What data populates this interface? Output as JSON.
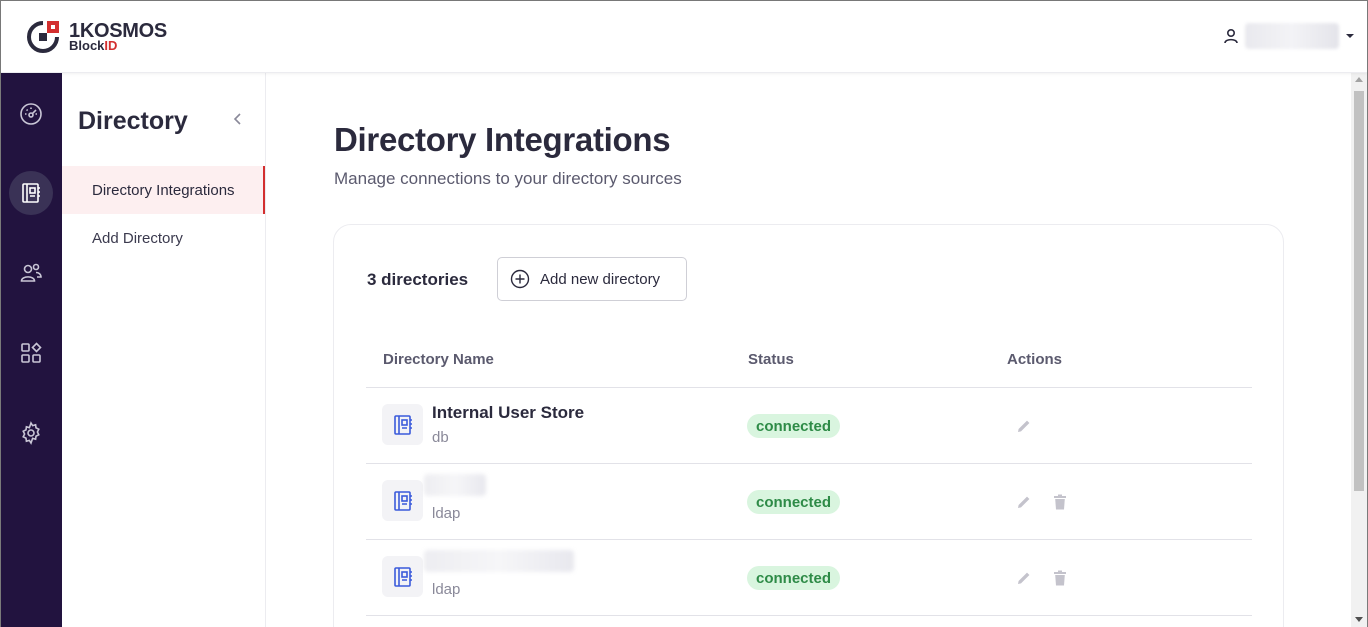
{
  "header": {
    "brand": "1KOSMOS",
    "product_prefix": "Block",
    "product_suffix": "ID",
    "user_icon": "user-icon",
    "menu_icon": "caret-down-icon"
  },
  "rail": {
    "items": [
      {
        "icon": "dashboard-icon",
        "active": false
      },
      {
        "icon": "directory-icon",
        "active": true
      },
      {
        "icon": "users-icon",
        "active": false
      },
      {
        "icon": "apps-icon",
        "active": false
      },
      {
        "icon": "settings-icon",
        "active": false
      }
    ]
  },
  "subnav": {
    "title": "Directory",
    "items": [
      {
        "label": "Directory Integrations",
        "active": true
      },
      {
        "label": "Add Directory",
        "active": false
      }
    ]
  },
  "main": {
    "title": "Directory Integrations",
    "subtitle": "Manage connections to your directory sources",
    "count_label": "3 directories",
    "add_button": "Add new directory",
    "table": {
      "columns": [
        "Directory Name",
        "Status",
        "Actions"
      ],
      "rows": [
        {
          "name": "Internal User Store",
          "type": "db",
          "status": "connected",
          "deletable": false
        },
        {
          "name": "",
          "type": "ldap",
          "status": "connected",
          "deletable": true
        },
        {
          "name": "",
          "type": "ldap",
          "status": "connected",
          "deletable": true
        }
      ]
    }
  },
  "colors": {
    "rail_bg": "#22133f",
    "accent_red": "#d32f2f",
    "status_green": "#2e8b47",
    "status_green_bg": "#d9f5df",
    "icon_blue": "#3b5bdb"
  }
}
